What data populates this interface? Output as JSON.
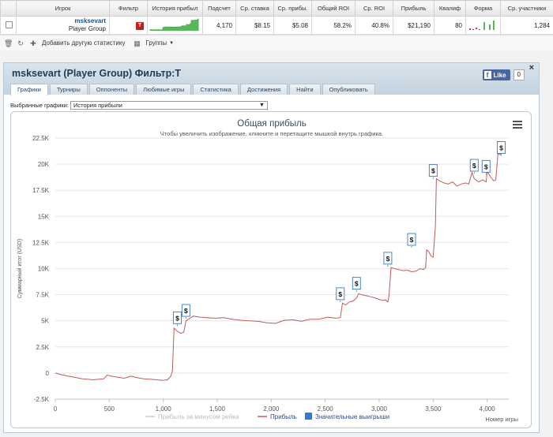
{
  "stats": {
    "headers": [
      "Игрок",
      "Фильтр",
      "История прибыл",
      "Подсчет",
      "Ср. ставка",
      "Ср. прибы.",
      "Общий ROI",
      "Ср. ROI",
      "Прибыль",
      "Квалиф",
      "Форма",
      "Ср. участники"
    ],
    "row": {
      "name": "msksevart",
      "group": "Player Group",
      "filter_badge": "T",
      "count": "4,170",
      "avg_stake": "$8.15",
      "avg_profit": "$5.08",
      "total_roi": "58.2%",
      "avg_roi": "40.8%",
      "profit": "$21,190",
      "qualif": "80",
      "avg_entrants": "1,284"
    }
  },
  "toolbar": {
    "add_stat": "Добавить другую статистику",
    "groups": "Группы"
  },
  "panel": {
    "title": "msksevart (Player Group) Фильтр:T",
    "close": "×",
    "fb_like": "Like",
    "fb_count": "0",
    "tabs": [
      "Графики",
      "Турниры",
      "Оппоненты",
      "Любимые игры",
      "Статистика",
      "Достижения",
      "Найти",
      "Опубликовать"
    ],
    "selected_label": "Выбранные графики:",
    "selected_value": "История прибыли"
  },
  "chart_data": {
    "type": "line",
    "title": "Общая прибыль",
    "subtitle": "Чтобы увеличить изображение, кликните и перетащите мышкой внутрь графика.",
    "ylabel": "Суммарный итог (USD)",
    "xlabel": "Номер игры",
    "xlim": [
      0,
      4200
    ],
    "ylim": [
      -2500,
      22500
    ],
    "x_ticks": [
      "0",
      "500",
      "1,000",
      "1,500",
      "2,000",
      "2,500",
      "3,000",
      "3,500",
      "4,000"
    ],
    "y_ticks": [
      "-2.5K",
      "0",
      "2.5K",
      "5K",
      "7.5K",
      "10K",
      "12.5K",
      "15K",
      "17.5K",
      "20K",
      "22.5K"
    ],
    "legend": [
      "Прибыль за минусом рейка",
      "Прибыль",
      "Значительные выигрыши"
    ],
    "colors": {
      "profit": "#c25a5a",
      "rake": "#d9d9d9",
      "wins": "#3779c6",
      "grid": "#e6e6e6"
    },
    "series": [
      {
        "name": "Прибыль",
        "points": [
          [
            0,
            0
          ],
          [
            50,
            -150
          ],
          [
            100,
            -250
          ],
          [
            150,
            -350
          ],
          [
            200,
            -450
          ],
          [
            250,
            -550
          ],
          [
            300,
            -600
          ],
          [
            350,
            -650
          ],
          [
            400,
            -600
          ],
          [
            450,
            -550
          ],
          [
            480,
            -200
          ],
          [
            520,
            -300
          ],
          [
            580,
            -400
          ],
          [
            640,
            -500
          ],
          [
            700,
            -300
          ],
          [
            760,
            -450
          ],
          [
            820,
            -550
          ],
          [
            880,
            -600
          ],
          [
            940,
            -650
          ],
          [
            990,
            -700
          ],
          [
            1040,
            -650
          ],
          [
            1070,
            -300
          ],
          [
            1085,
            200
          ],
          [
            1100,
            4300
          ],
          [
            1130,
            4000
          ],
          [
            1160,
            3800
          ],
          [
            1190,
            3900
          ],
          [
            1210,
            5000
          ],
          [
            1240,
            5200
          ],
          [
            1280,
            5450
          ],
          [
            1340,
            5350
          ],
          [
            1400,
            5300
          ],
          [
            1480,
            5250
          ],
          [
            1560,
            5300
          ],
          [
            1640,
            5150
          ],
          [
            1720,
            5050
          ],
          [
            1800,
            5000
          ],
          [
            1880,
            4950
          ],
          [
            1960,
            4800
          ],
          [
            2040,
            4750
          ],
          [
            2120,
            5050
          ],
          [
            2200,
            5100
          ],
          [
            2280,
            4950
          ],
          [
            2360,
            5150
          ],
          [
            2440,
            5150
          ],
          [
            2520,
            5350
          ],
          [
            2600,
            5250
          ],
          [
            2640,
            5300
          ],
          [
            2660,
            6700
          ],
          [
            2690,
            6500
          ],
          [
            2720,
            6800
          ],
          [
            2760,
            6900
          ],
          [
            2790,
            7200
          ],
          [
            2810,
            7600
          ],
          [
            2840,
            7500
          ],
          [
            2880,
            7400
          ],
          [
            2920,
            7300
          ],
          [
            2960,
            7200
          ],
          [
            3000,
            7050
          ],
          [
            3030,
            6950
          ],
          [
            3060,
            7000
          ],
          [
            3080,
            6800
          ],
          [
            3090,
            7300
          ],
          [
            3110,
            10100
          ],
          [
            3140,
            10000
          ],
          [
            3180,
            9900
          ],
          [
            3220,
            9800
          ],
          [
            3260,
            9850
          ],
          [
            3300,
            9700
          ],
          [
            3340,
            9750
          ],
          [
            3380,
            10000
          ],
          [
            3410,
            9900
          ],
          [
            3430,
            10100
          ],
          [
            3440,
            11800
          ],
          [
            3460,
            11600
          ],
          [
            3480,
            11200
          ],
          [
            3500,
            11100
          ],
          [
            3520,
            14000
          ],
          [
            3530,
            18600
          ],
          [
            3560,
            18400
          ],
          [
            3600,
            18200
          ],
          [
            3640,
            18100
          ],
          [
            3680,
            18300
          ],
          [
            3720,
            17900
          ],
          [
            3760,
            18100
          ],
          [
            3800,
            18200
          ],
          [
            3830,
            18100
          ],
          [
            3860,
            19200
          ],
          [
            3880,
            18600
          ],
          [
            3920,
            18300
          ],
          [
            3960,
            18500
          ],
          [
            3990,
            18300
          ],
          [
            4000,
            19300
          ],
          [
            4030,
            18800
          ],
          [
            4060,
            18400
          ],
          [
            4080,
            18500
          ],
          [
            4100,
            21000
          ],
          [
            4120,
            20900
          ],
          [
            4140,
            21200
          ]
        ]
      }
    ],
    "big_wins": [
      [
        1130,
        4500
      ],
      [
        1210,
        5200
      ],
      [
        2640,
        6800
      ],
      [
        2790,
        7800
      ],
      [
        3080,
        10200
      ],
      [
        3300,
        12000
      ],
      [
        3500,
        18600
      ],
      [
        3880,
        19100
      ],
      [
        3990,
        19000
      ],
      [
        4130,
        20800
      ]
    ]
  }
}
